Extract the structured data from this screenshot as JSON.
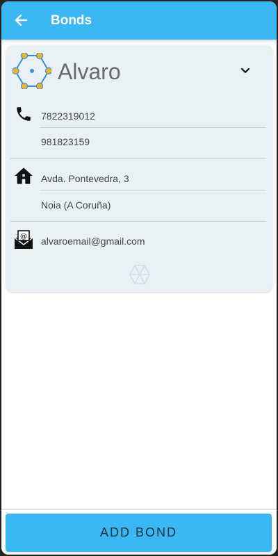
{
  "app_bar": {
    "back_icon": "arrow-left-icon",
    "title": "Bonds"
  },
  "bond": {
    "name": "Alvaro",
    "logo_icon": "bond-network-icon",
    "expand_icon": "chevron-down-icon",
    "phone": {
      "icon": "phone-icon",
      "numbers": [
        "7822319012",
        "981823159"
      ]
    },
    "address": {
      "icon": "home-icon",
      "lines": [
        "Avda. Pontevedra, 3",
        "Noia (A Coruña)"
      ]
    },
    "email": {
      "icon": "email-icon",
      "value": "alvaroemail@gmail.com"
    },
    "watermark_icon": "snowflake-icon"
  },
  "footer": {
    "add_button_label": "ADD BOND"
  },
  "colors": {
    "accent": "#3bb7f3",
    "card_bg": "#e9f1f5",
    "logo_node": "#f2b32c",
    "logo_ring": "#3a8fd6"
  }
}
